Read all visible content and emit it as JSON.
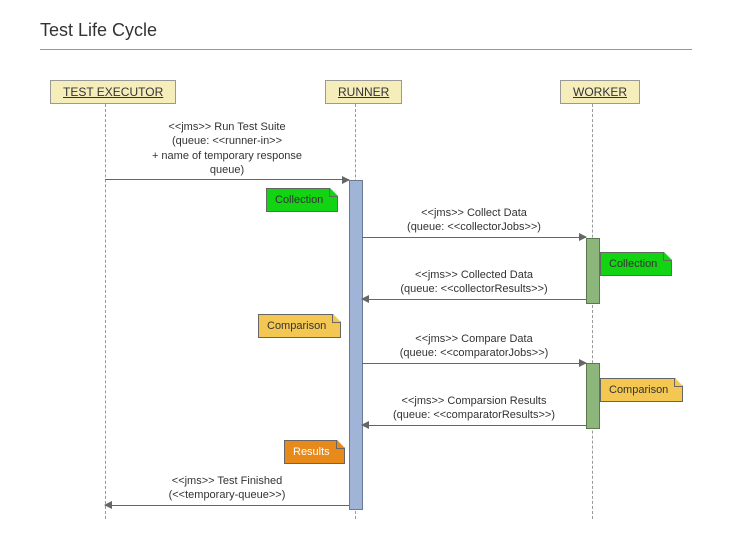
{
  "title": "Test Life Cycle",
  "participants": {
    "executor": "TEST EXECUTOR",
    "runner": "RUNNER",
    "worker": "WORKER"
  },
  "messages": {
    "run_suite_l1": "<<jms>> Run Test Suite",
    "run_suite_l2": "(queue: <<runner-in>>",
    "run_suite_l3": "+ name of temporary response",
    "run_suite_l4": "queue)",
    "collect_l1": "<<jms>> Collect Data",
    "collect_l2": "(queue: <<collectorJobs>>)",
    "collected_l1": "<<jms>> Collected Data",
    "collected_l2": "(queue: <<collectorResults>>)",
    "compare_l1": "<<jms>> Compare Data",
    "compare_l2": "(queue: <<comparatorJobs>>)",
    "compresult_l1": "<<jms>> Comparsion Results",
    "compresult_l2": "(queue: <<comparatorResults>>)",
    "finished_l1": "<<jms>> Test Finished",
    "finished_l2": "(<<temporary-queue>>)"
  },
  "notes": {
    "collection": "Collection",
    "comparison": "Comparison",
    "results": "Results"
  },
  "chart_data": {
    "type": "sequence-diagram",
    "title": "Test Life Cycle",
    "participants": [
      "TEST EXECUTOR",
      "RUNNER",
      "WORKER"
    ],
    "events": [
      {
        "from": "TEST EXECUTOR",
        "to": "RUNNER",
        "label": "<<jms>> Run Test Suite (queue: <<runner-in>> + name of temporary response queue)"
      },
      {
        "note_on": "RUNNER",
        "side": "left",
        "text": "Collection",
        "color": "green"
      },
      {
        "from": "RUNNER",
        "to": "WORKER",
        "label": "<<jms>> Collect Data (queue: <<collectorJobs>>)"
      },
      {
        "note_on": "WORKER",
        "side": "right",
        "text": "Collection",
        "color": "green"
      },
      {
        "from": "WORKER",
        "to": "RUNNER",
        "label": "<<jms>> Collected Data (queue: <<collectorResults>>)"
      },
      {
        "note_on": "RUNNER",
        "side": "left",
        "text": "Comparison",
        "color": "yellow"
      },
      {
        "from": "RUNNER",
        "to": "WORKER",
        "label": "<<jms>> Compare Data (queue: <<comparatorJobs>>)"
      },
      {
        "note_on": "WORKER",
        "side": "right",
        "text": "Comparison",
        "color": "yellow"
      },
      {
        "from": "WORKER",
        "to": "RUNNER",
        "label": "<<jms>> Comparsion Results (queue: <<comparatorResults>>)"
      },
      {
        "note_on": "RUNNER",
        "side": "left",
        "text": "Results",
        "color": "orange"
      },
      {
        "from": "RUNNER",
        "to": "TEST EXECUTOR",
        "label": "<<jms>> Test Finished (<<temporary-queue>>)"
      }
    ]
  }
}
